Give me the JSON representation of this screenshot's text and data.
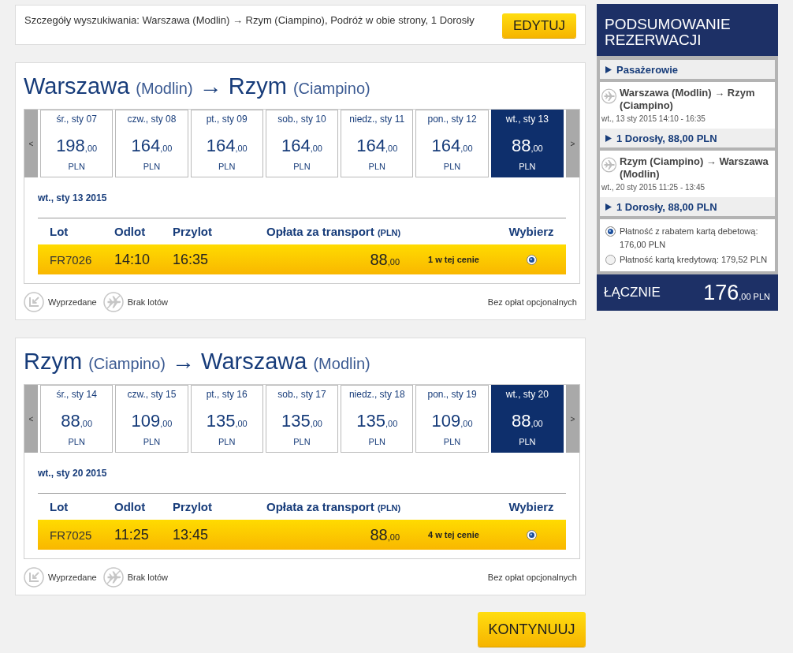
{
  "search": {
    "summary": "Szczegóły wyszukiwania: Warszawa (Modlin) → Rzym (Ciampino), Podróż w obie strony, 1 Dorosły",
    "edit_button": "EDYTUJ"
  },
  "journeys": [
    {
      "origin": "Warszawa",
      "origin_airport": "(Modlin)",
      "arrow": "→",
      "destination": "Rzym",
      "destination_airport": "(Ciampino)",
      "prev_button": "<",
      "next_button": ">",
      "dates": [
        {
          "label": "śr., sty 07",
          "price": "198",
          "decimals": ",00",
          "currency": "PLN",
          "selected": false
        },
        {
          "label": "czw., sty 08",
          "price": "164",
          "decimals": ",00",
          "currency": "PLN",
          "selected": false
        },
        {
          "label": "pt., sty 09",
          "price": "164",
          "decimals": ",00",
          "currency": "PLN",
          "selected": false
        },
        {
          "label": "sob., sty 10",
          "price": "164",
          "decimals": ",00",
          "currency": "PLN",
          "selected": false
        },
        {
          "label": "niedz., sty 11",
          "price": "164",
          "decimals": ",00",
          "currency": "PLN",
          "selected": false
        },
        {
          "label": "pon., sty 12",
          "price": "164",
          "decimals": ",00",
          "currency": "PLN",
          "selected": false
        },
        {
          "label": "wt., sty 13",
          "price": "88",
          "decimals": ",00",
          "currency": "PLN",
          "selected": true
        }
      ],
      "selected_date": "wt., sty 13 2015",
      "columns": [
        {
          "kind": "flight",
          "label": "Lot"
        },
        {
          "kind": "departure",
          "label": "Odlot"
        },
        {
          "kind": "arrival",
          "label": "Przylot"
        },
        {
          "kind": "fare",
          "label": "Opłata za transport",
          "unit": "(PLN)"
        },
        {
          "kind": "select",
          "label": "Wybierz"
        }
      ],
      "flights": [
        {
          "number": "FR7026",
          "departure": "14:10",
          "arrival": "16:35",
          "price": "88",
          "decimals": ",00",
          "availability": "1 w tej cenie",
          "selected": true
        }
      ],
      "legend": [
        {
          "kind": "sold_out",
          "label": "Wyprzedane"
        },
        {
          "kind": "no_flights",
          "label": "Brak lotów"
        }
      ],
      "note": "Bez opłat opcjonalnych"
    },
    {
      "origin": "Rzym",
      "origin_airport": "(Ciampino)",
      "arrow": "→",
      "destination": "Warszawa",
      "destination_airport": "(Modlin)",
      "prev_button": "<",
      "next_button": ">",
      "dates": [
        {
          "label": "śr., sty 14",
          "price": "88",
          "decimals": ",00",
          "currency": "PLN",
          "selected": false
        },
        {
          "label": "czw., sty 15",
          "price": "109",
          "decimals": ",00",
          "currency": "PLN",
          "selected": false
        },
        {
          "label": "pt., sty 16",
          "price": "135",
          "decimals": ",00",
          "currency": "PLN",
          "selected": false
        },
        {
          "label": "sob., sty 17",
          "price": "135",
          "decimals": ",00",
          "currency": "PLN",
          "selected": false
        },
        {
          "label": "niedz., sty 18",
          "price": "135",
          "decimals": ",00",
          "currency": "PLN",
          "selected": false
        },
        {
          "label": "pon., sty 19",
          "price": "109",
          "decimals": ",00",
          "currency": "PLN",
          "selected": false
        },
        {
          "label": "wt., sty 20",
          "price": "88",
          "decimals": ",00",
          "currency": "PLN",
          "selected": true
        }
      ],
      "selected_date": "wt., sty 20 2015",
      "columns": [
        {
          "kind": "flight",
          "label": "Lot"
        },
        {
          "kind": "departure",
          "label": "Odlot"
        },
        {
          "kind": "arrival",
          "label": "Przylot"
        },
        {
          "kind": "fare",
          "label": "Opłata za transport",
          "unit": "(PLN)"
        },
        {
          "kind": "select",
          "label": "Wybierz"
        }
      ],
      "flights": [
        {
          "number": "FR7025",
          "departure": "11:25",
          "arrival": "13:45",
          "price": "88",
          "decimals": ",00",
          "availability": "4 w tej cenie",
          "selected": true
        }
      ],
      "legend": [
        {
          "kind": "sold_out",
          "label": "Wyprzedane"
        },
        {
          "kind": "no_flights",
          "label": "Brak lotów"
        }
      ],
      "note": "Bez opłat opcjonalnych"
    }
  ],
  "continue_button": "KONTYNUUJ",
  "summary": {
    "title": "PODSUMOWANIE REZERWACJI",
    "passengers": "Pasażerowie",
    "legs": [
      {
        "route": "Warszawa (Modlin) → Rzym (Ciampino)",
        "time": "wt., 13 sty 2015 14:10 - 16:35",
        "fare": "1 Dorosły, 88,00 PLN"
      },
      {
        "route": "Rzym (Ciampino) → Warszawa (Modlin)",
        "time": "wt., 20 sty 2015 11:25 - 13:45",
        "fare": "1 Dorosły, 88,00 PLN"
      }
    ],
    "payment_options": [
      {
        "label": "Płatność z rabatem kartą debetową: 176,00 PLN",
        "selected": true
      },
      {
        "label": "Płatność kartą kredytową: 179,52 PLN",
        "selected": false
      }
    ],
    "total": {
      "label": "ŁĄCZNIE",
      "amount": "176",
      "decimals": ",00",
      "currency": "PLN"
    }
  }
}
